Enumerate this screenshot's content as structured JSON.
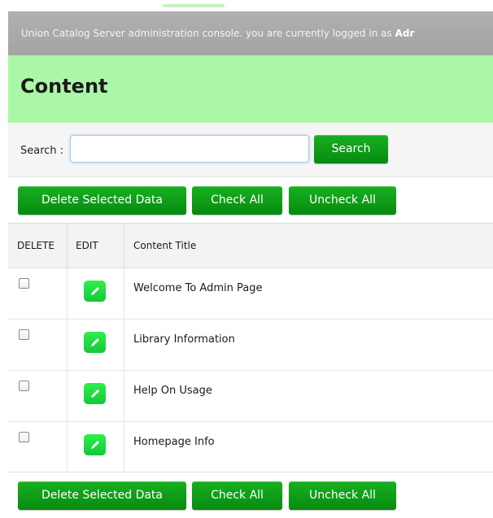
{
  "header": {
    "status_prefix": "Union Catalog Server administration console. you are currently logged in as ",
    "user": "Adr"
  },
  "page": {
    "title": "Content"
  },
  "search": {
    "label": "Search :",
    "placeholder": "",
    "value": "",
    "button_label": "Search"
  },
  "actions": {
    "delete_selected_label": "Delete Selected Data",
    "check_all_label": "Check All",
    "uncheck_all_label": "Uncheck All"
  },
  "table": {
    "columns": [
      "DELETE",
      "EDIT",
      "Content Title"
    ],
    "rows": [
      {
        "title": "Welcome To Admin Page",
        "checked": false
      },
      {
        "title": "Library Information",
        "checked": false
      },
      {
        "title": "Help On Usage",
        "checked": false
      },
      {
        "title": "Homepage Info",
        "checked": false
      }
    ]
  },
  "icons": {
    "edit": "pencil-icon"
  },
  "colors": {
    "header_bg": "#a8a8a8",
    "title_bar_bg": "#aaf7a8",
    "button_green": "#0c9a14",
    "edit_icon_green": "#1fdc40"
  }
}
